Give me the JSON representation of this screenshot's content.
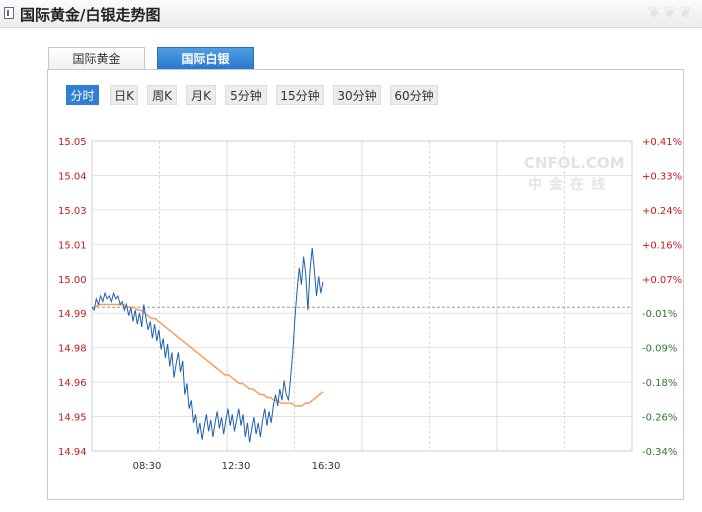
{
  "header": {
    "title": "国际黄金/白银走势图",
    "decoration": "❦❦❦"
  },
  "tabs": [
    {
      "label": "国际黄金",
      "active": false
    },
    {
      "label": "国际白银",
      "active": true
    }
  ],
  "periods": [
    {
      "label": "分时",
      "active": true
    },
    {
      "label": "日K",
      "active": false
    },
    {
      "label": "周K",
      "active": false
    },
    {
      "label": "月K",
      "active": false
    },
    {
      "label": "5分钟",
      "active": false
    },
    {
      "label": "15分钟",
      "active": false
    },
    {
      "label": "30分钟",
      "active": false
    },
    {
      "label": "60分钟",
      "active": false
    }
  ],
  "watermark": {
    "line1": "CNFOL.COM",
    "line2": "中金在线"
  },
  "chart_data": {
    "type": "line",
    "title": "",
    "xlabel": "",
    "ylabel": "",
    "ylim": [
      14.94,
      15.05
    ],
    "y_ticks_left": [
      "15.05",
      "15.04",
      "15.03",
      "15.01",
      "15.00",
      "14.99",
      "14.98",
      "14.96",
      "14.95",
      "14.94"
    ],
    "y_ticks_right": [
      "+0.41%",
      "+0.33%",
      "+0.24%",
      "+0.16%",
      "+0.07%",
      "-0.01%",
      "-0.09%",
      "-0.18%",
      "-0.26%",
      "-0.34%"
    ],
    "x_ticks": [
      "08:30",
      "12:30",
      "16:30"
    ],
    "reference_price": 14.991,
    "grid": true,
    "colors": {
      "price": "#1f5fae",
      "average": "#f0a060",
      "reference": "#999999",
      "up": "#c81a1a",
      "down": "#2f7a2f"
    },
    "series": [
      {
        "values": [
          14.991,
          14.99,
          14.994,
          14.992,
          14.995,
          14.993,
          14.996,
          14.994,
          14.995,
          14.993,
          14.996,
          14.994,
          14.995,
          14.992,
          14.993,
          14.99,
          14.992,
          14.988,
          14.991,
          14.986,
          14.99,
          14.985,
          14.989,
          14.984,
          14.992,
          14.987,
          14.983,
          14.986,
          14.98,
          14.985,
          14.979,
          14.983,
          14.976,
          14.98,
          14.973,
          14.978,
          14.97,
          14.975,
          14.966,
          14.971,
          14.975,
          14.968,
          14.972,
          14.96,
          14.964,
          14.955,
          14.958,
          14.95,
          14.953,
          14.946,
          14.95,
          14.944,
          14.949,
          14.953,
          14.947,
          14.951,
          14.945,
          14.95,
          14.954,
          14.948,
          14.952,
          14.946,
          14.951,
          14.955,
          14.949,
          14.953,
          14.947,
          14.951,
          14.955,
          14.949,
          14.953,
          14.945,
          14.95,
          14.943,
          14.948,
          14.952,
          14.946,
          14.95,
          14.945,
          14.951,
          14.955,
          14.949,
          14.954,
          14.95,
          14.956,
          14.96,
          14.956,
          14.962,
          14.958,
          14.965,
          14.96,
          14.958,
          14.966,
          14.975,
          14.987,
          14.997,
          15.005,
          14.999,
          15.009,
          15.003,
          14.99,
          15.004,
          15.012,
          15.004,
          14.995,
          15.002,
          14.996,
          15.0
        ]
      },
      {
        "values": [
          14.991,
          14.991,
          14.992,
          14.992,
          14.992,
          14.992,
          14.992,
          14.992,
          14.992,
          14.992,
          14.991,
          14.991,
          14.991,
          14.99,
          14.99,
          14.989,
          14.988,
          14.987,
          14.987,
          14.986,
          14.985,
          14.984,
          14.983,
          14.982,
          14.981,
          14.98,
          14.979,
          14.978,
          14.977,
          14.976,
          14.975,
          14.974,
          14.973,
          14.972,
          14.971,
          14.97,
          14.969,
          14.968,
          14.967,
          14.967,
          14.966,
          14.965,
          14.964,
          14.964,
          14.963,
          14.962,
          14.962,
          14.961,
          14.96,
          14.96,
          14.959,
          14.959,
          14.958,
          14.958,
          14.957,
          14.957,
          14.957,
          14.957,
          14.956,
          14.956,
          14.956,
          14.957,
          14.957,
          14.958,
          14.959,
          14.96,
          14.961
        ]
      }
    ]
  }
}
